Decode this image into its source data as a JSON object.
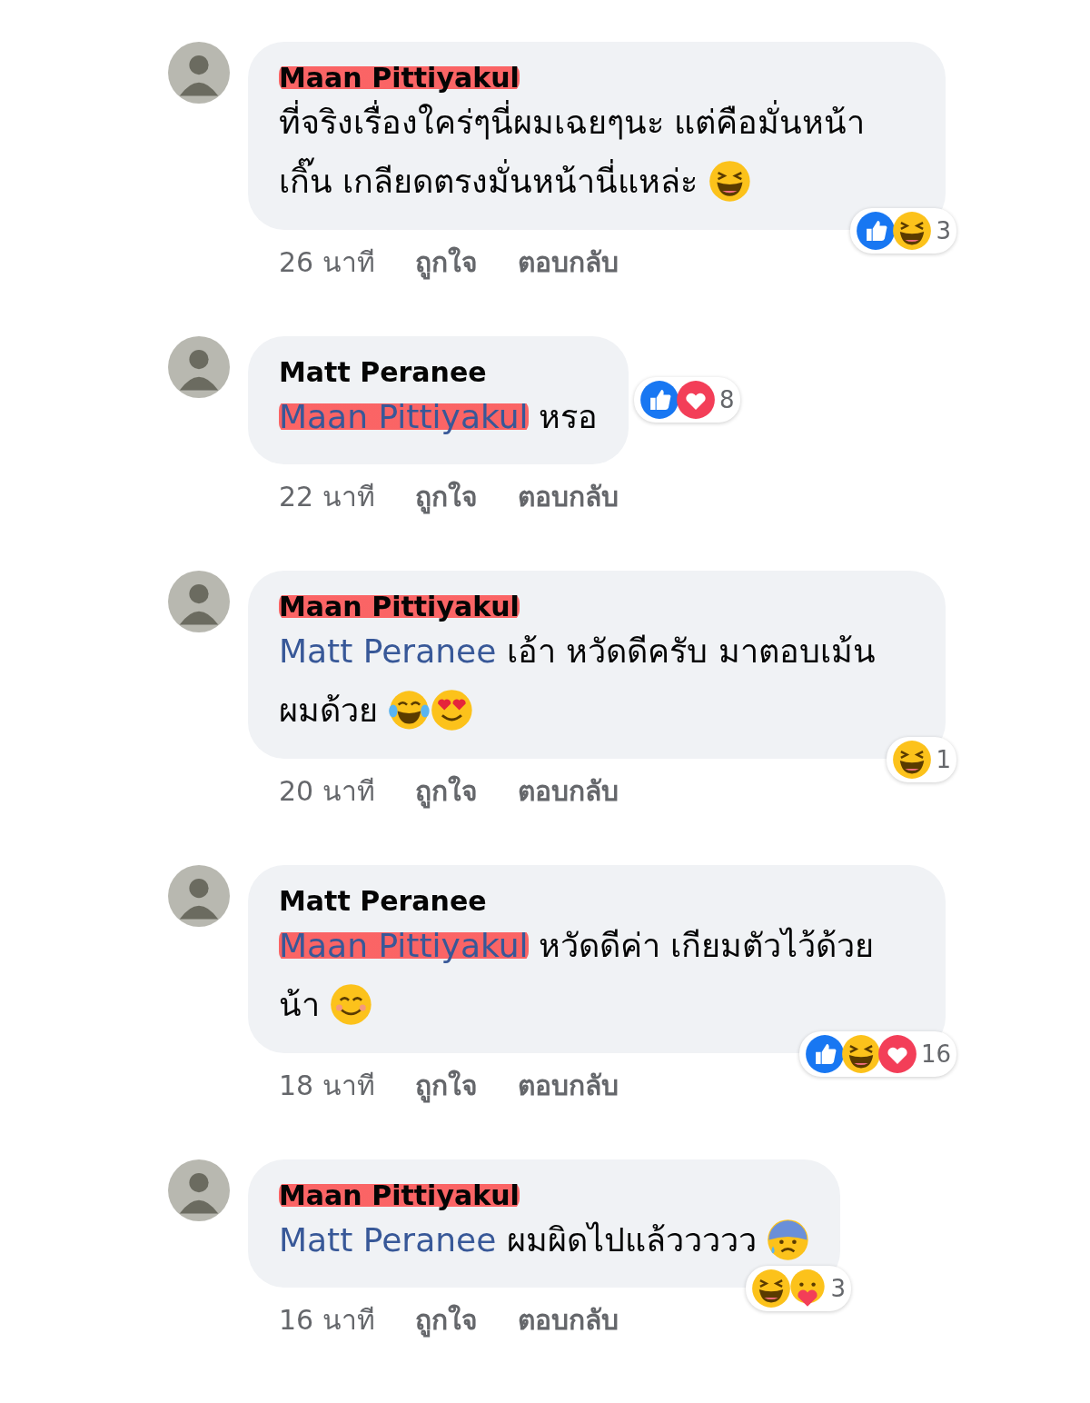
{
  "comments": [
    {
      "author": "Maan Pittiyakul",
      "author_redacted": true,
      "text": "ที่จริงเรื่องใคร่ๆนี่ผมเฉยๆนะ แต่คือมั่นหน้าเกิ๊น เกลียดตรงมั่นหน้านี่แหล่ะ",
      "emojis": [
        {
          "kind": "squint-grin"
        }
      ],
      "time": "26 นาที",
      "like_label": "ถูกใจ",
      "reply_label": "ตอบกลับ",
      "reactions": [
        {
          "kind": "like"
        },
        {
          "kind": "haha"
        }
      ],
      "reaction_count": "3"
    },
    {
      "author": "Matt Peranee",
      "mention": {
        "name": "Maan Pittiyakul",
        "redacted": true
      },
      "text": "หรอ",
      "time": "22 นาที",
      "like_label": "ถูกใจ",
      "reply_label": "ตอบกลับ",
      "reactions": [
        {
          "kind": "like"
        },
        {
          "kind": "love"
        }
      ],
      "reaction_count": "8"
    },
    {
      "author": "Maan Pittiyakul",
      "author_redacted": true,
      "mention": {
        "name": "Matt Peranee"
      },
      "text": "เอ้า หวัดดีครับ มาตอบเม้นผมด้วย",
      "emojis": [
        {
          "kind": "tears-of-joy"
        },
        {
          "kind": "heart-eyes"
        }
      ],
      "time": "20 นาที",
      "like_label": "ถูกใจ",
      "reply_label": "ตอบกลับ",
      "reactions": [
        {
          "kind": "haha"
        }
      ],
      "reaction_count": "1"
    },
    {
      "author": "Matt Peranee",
      "mention": {
        "name": "Maan Pittiyakul",
        "redacted": true
      },
      "text": "หวัดดีค่า เกียมตัวไว้ด้วยน้า",
      "emojis": [
        {
          "kind": "smiling"
        }
      ],
      "time": "18 นาที",
      "like_label": "ถูกใจ",
      "reply_label": "ตอบกลับ",
      "reactions": [
        {
          "kind": "like"
        },
        {
          "kind": "haha"
        },
        {
          "kind": "love"
        }
      ],
      "reaction_count": "16"
    },
    {
      "author": "Maan Pittiyakul",
      "author_redacted": true,
      "mention": {
        "name": "Matt Peranee"
      },
      "text": "ผมผิดไปแล้ววววว",
      "emojis": [
        {
          "kind": "anxious-sweat"
        }
      ],
      "time": "16 นาที",
      "like_label": "ถูกใจ",
      "reply_label": "ตอบกลับ",
      "reactions": [
        {
          "kind": "haha"
        },
        {
          "kind": "care"
        }
      ],
      "reaction_count": "3"
    }
  ]
}
